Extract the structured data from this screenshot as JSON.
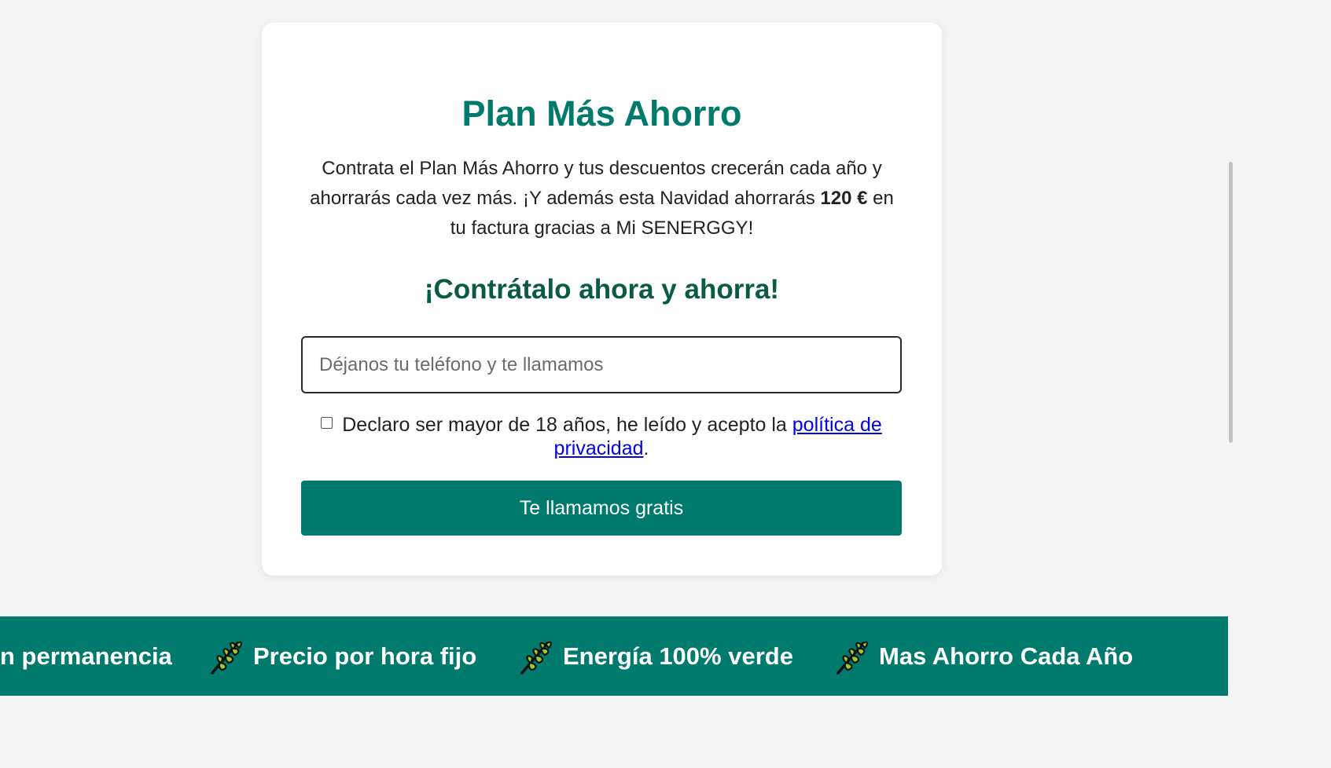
{
  "card": {
    "title": "Plan Más Ahorro",
    "description_line_1": "Contrata el Plan Más Ahorro y tus descuentos crecerán cada año y ahorrarás cada vez más. ¡Y además esta Navidad ahorrarás ",
    "description_bold": "120 €",
    "description_line_2": " en tu factura gracias a Mi SENERGGY!",
    "subtitle": "¡Contrátalo ahora y ahorra!",
    "phone_placeholder": "Déjanos tu teléfono y te llamamos",
    "phone_value": "",
    "consent_text": "Declaro ser mayor de 18 años, he leído y acepto la ",
    "consent_link": "política de privacidad",
    "consent_end": ".",
    "consent_checked": false,
    "cta_label": "Te llamamos gratis"
  },
  "ticker": {
    "icon": "leaf-icon",
    "items": [
      "n permanencia",
      "Precio por hora fijo",
      "Energía 100% verde",
      "Mas Ahorro Cada Año"
    ]
  },
  "colors": {
    "brand_green": "#007a6c",
    "subtitle_green": "#0b5a45",
    "background": "#f4f4f4",
    "link": "#0000ee"
  }
}
